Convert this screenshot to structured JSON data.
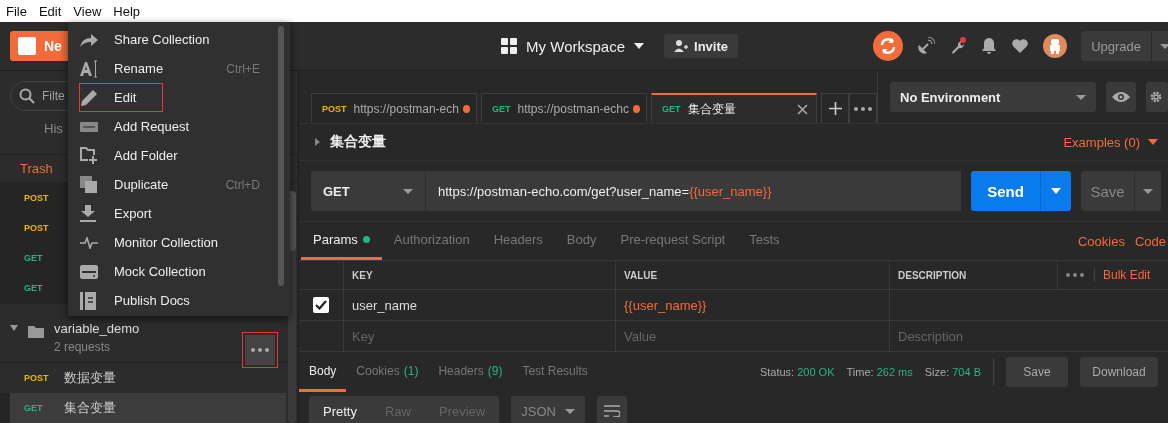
{
  "menu_bar": [
    "File",
    "Edit",
    "View",
    "Help"
  ],
  "header": {
    "new_button": "Ne",
    "workspace": "My Workspace",
    "invite": "Invite",
    "upgrade": "Upgrade"
  },
  "sidebar": {
    "search_placeholder": "Filte",
    "tab": "His",
    "trash": "Trash",
    "requests": [
      {
        "method": "POST"
      },
      {
        "method": "POST"
      },
      {
        "method": "GET"
      },
      {
        "method": "GET"
      }
    ],
    "collection": {
      "name": "variable_demo",
      "count": "2 requests",
      "more_highlighted": true,
      "requests": [
        {
          "method": "POST",
          "name": "数据变量",
          "selected": false
        },
        {
          "method": "GET",
          "name": "集合变量",
          "selected": true
        }
      ]
    }
  },
  "context_menu": [
    {
      "kind": "share",
      "label": "Share Collection",
      "highlighted": false
    },
    {
      "kind": "rename",
      "label": "Rename",
      "shortcut": "Ctrl+E",
      "highlighted": false
    },
    {
      "kind": "edit",
      "label": "Edit",
      "highlighted": true
    },
    {
      "kind": "request",
      "label": "Add Request",
      "highlighted": false
    },
    {
      "kind": "folder",
      "label": "Add Folder",
      "highlighted": false
    },
    {
      "kind": "duplicate",
      "label": "Duplicate",
      "shortcut": "Ctrl+D",
      "highlighted": false
    },
    {
      "kind": "export",
      "label": "Export",
      "highlighted": false
    },
    {
      "kind": "monitor",
      "label": "Monitor Collection",
      "highlighted": false
    },
    {
      "kind": "mock",
      "label": "Mock Collection",
      "highlighted": false
    },
    {
      "kind": "docs",
      "label": "Publish Docs",
      "highlighted": false
    }
  ],
  "tabs": [
    {
      "method": "POST",
      "title": "https://postman-ech",
      "unsaved": true,
      "selected": false
    },
    {
      "method": "GET",
      "title": "https://postman-echc",
      "unsaved": true,
      "selected": false
    },
    {
      "method": "GET",
      "title": "集合变量",
      "unsaved": false,
      "selected": true
    }
  ],
  "environment": "No Environment",
  "request": {
    "name": "集合变量",
    "examples": "Examples (0)",
    "method": "GET",
    "url": "https://postman-echo.com/get?user_name=",
    "url_variable": "{{user_name}}",
    "send": "Send",
    "save": "Save"
  },
  "request_tabs": [
    {
      "label": "Params",
      "selected": true,
      "dot": true
    },
    {
      "label": "Authorization",
      "selected": false,
      "dot": false
    },
    {
      "label": "Headers",
      "selected": false,
      "dot": false
    },
    {
      "label": "Body",
      "selected": false,
      "dot": false
    },
    {
      "label": "Pre-request Script",
      "selected": false,
      "dot": false
    },
    {
      "label": "Tests",
      "selected": false,
      "dot": false
    }
  ],
  "request_links": [
    "Cookies",
    "Code"
  ],
  "params": {
    "columns": [
      "KEY",
      "VALUE",
      "DESCRIPTION"
    ],
    "bulk_edit": "Bulk Edit",
    "rows": [
      {
        "checked": true,
        "key": "user_name",
        "value": "{{user_name}}"
      }
    ],
    "new_row": [
      {
        "placeholder": "Key"
      },
      {
        "placeholder": "Value"
      },
      {
        "placeholder": "Description"
      }
    ]
  },
  "response_tabs": [
    {
      "label": "Body",
      "selected": true
    },
    {
      "label": "Cookies",
      "count": "(1)",
      "selected": false
    },
    {
      "label": "Headers",
      "count": "(9)",
      "selected": false
    },
    {
      "label": "Test Results",
      "selected": false
    }
  ],
  "response_status": [
    {
      "label": "Status:",
      "value": "200 OK"
    },
    {
      "label": "Time:",
      "value": "262 ms"
    },
    {
      "label": "Size:",
      "value": "704 B"
    }
  ],
  "response_buttons": [
    "Save",
    "Download"
  ],
  "view_modes": [
    {
      "label": "Pretty",
      "selected": true
    },
    {
      "label": "Raw",
      "selected": false
    },
    {
      "label": "Preview",
      "selected": false
    }
  ],
  "format": "JSON"
}
